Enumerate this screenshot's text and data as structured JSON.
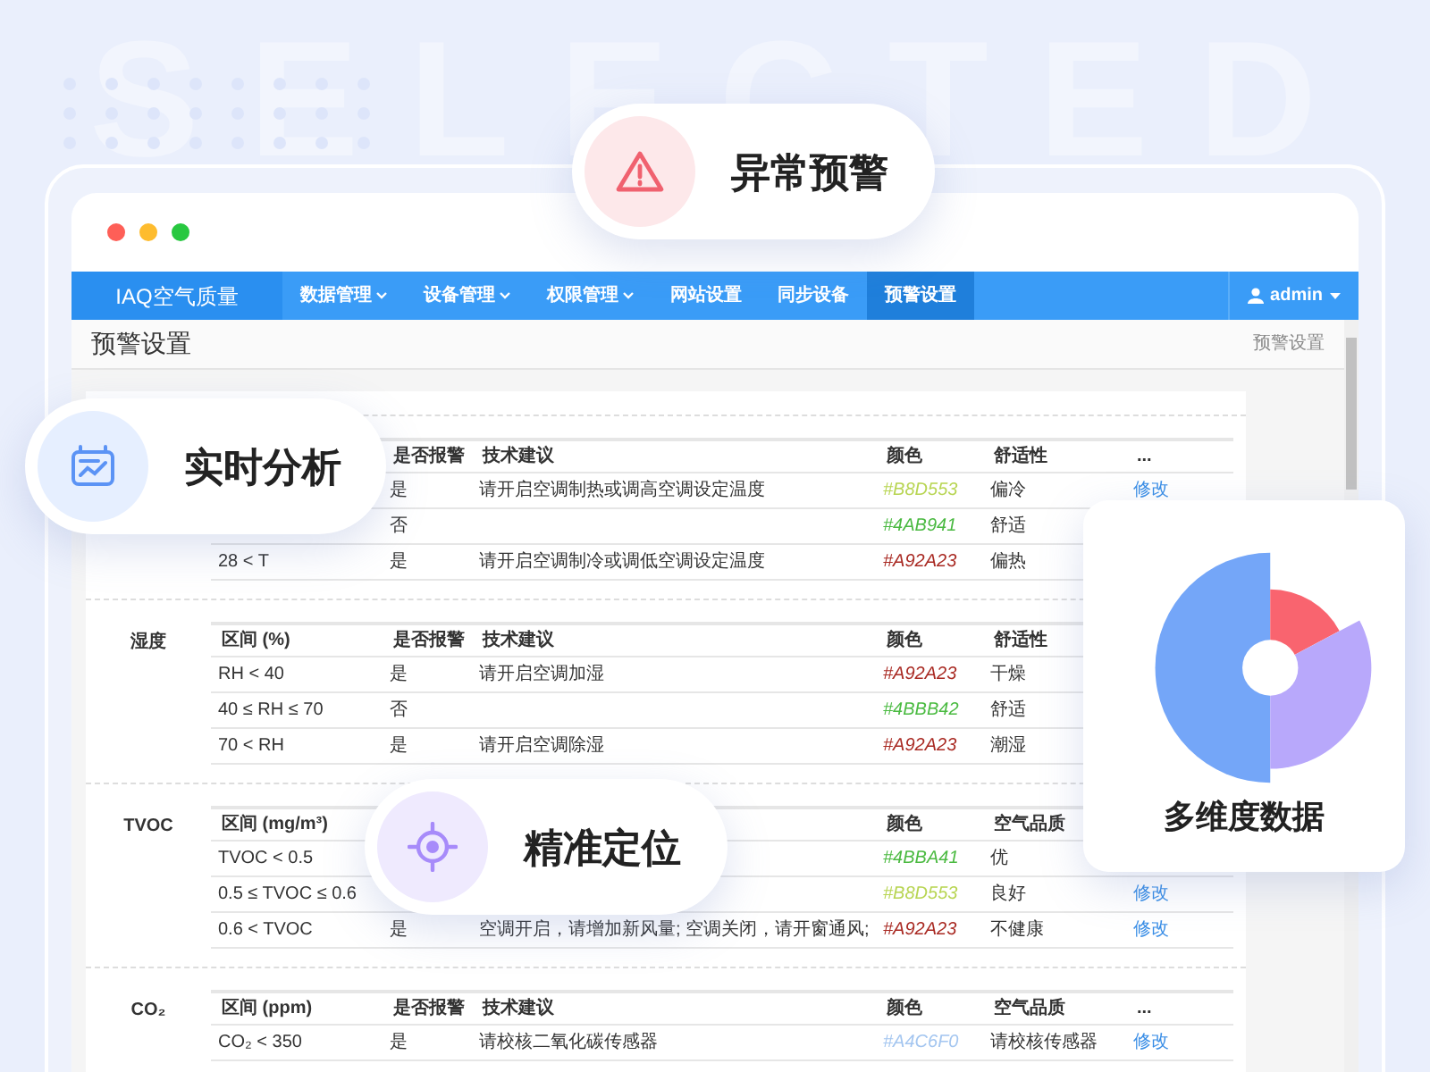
{
  "background_text": "SELECTED",
  "badges": [
    {
      "kind": "warning",
      "label": "异常预警"
    },
    {
      "kind": "analysis",
      "label": "实时分析"
    },
    {
      "kind": "locate",
      "label": "精准定位"
    }
  ],
  "chart_card": {
    "label": "多维度数据"
  },
  "window": {
    "brand": "IAQ空气质量",
    "nav": [
      {
        "label": "数据管理",
        "has_menu": true,
        "selected": false
      },
      {
        "label": "设备管理",
        "has_menu": true,
        "selected": false
      },
      {
        "label": "权限管理",
        "has_menu": true,
        "selected": false
      },
      {
        "label": "网站设置",
        "has_menu": false,
        "selected": false
      },
      {
        "label": "同步设备",
        "has_menu": false,
        "selected": false
      },
      {
        "label": "预警设置",
        "has_menu": false,
        "selected": true
      }
    ],
    "user": "admin",
    "page_title": "预警设置",
    "breadcrumb": "预警设置",
    "sections": [
      {
        "columns": [
          null,
          "是否报警",
          "技术建议",
          "颜色",
          "舒适性",
          "..."
        ],
        "rows": [
          {
            "cells": [
              null,
              "是",
              "请开启空调制热或调高空调设定温度",
              {
                "text": "#B8D553",
                "color": "#b8d553"
              },
              "偏冷",
              "修改"
            ]
          },
          {
            "cells": [
              null,
              "否",
              null,
              {
                "text": "#4AB941",
                "color": "#4ab941"
              },
              "舒适",
              null
            ]
          },
          {
            "cells": [
              "28 < T",
              "是",
              "请开启空调制冷或调低空调设定温度",
              {
                "text": "#A92A23",
                "color": "#a92a23"
              },
              "偏热",
              null
            ]
          }
        ]
      },
      {
        "label": "湿度",
        "columns": [
          "区间 (%)",
          "是否报警",
          "技术建议",
          "颜色",
          "舒适性",
          null
        ],
        "rows": [
          {
            "cells": [
              "RH < 40",
              "是",
              "请开启空调加湿",
              {
                "text": "#A92A23",
                "color": "#a92a23"
              },
              "干燥",
              null
            ]
          },
          {
            "cells": [
              "40 ≤ RH ≤ 70",
              "否",
              null,
              {
                "text": "#4BBB42",
                "color": "#4bbb42"
              },
              "舒适",
              null
            ]
          },
          {
            "cells": [
              "70 < RH",
              "是",
              "请开启空调除湿",
              {
                "text": "#A92A23",
                "color": "#a92a23"
              },
              "潮湿",
              null
            ]
          }
        ]
      },
      {
        "label": "TVOC",
        "columns": [
          "区间 (mg/m³)",
          null,
          null,
          "颜色",
          "空气品质",
          null
        ],
        "rows": [
          {
            "cells": [
              "TVOC < 0.5",
              null,
              null,
              {
                "text": "#4BBA41",
                "color": "#4bba41"
              },
              "优",
              null
            ]
          },
          {
            "cells": [
              "0.5 ≤ TVOC ≤ 0.6",
              null,
              null,
              {
                "text": "#B8D553",
                "color": "#b8d553"
              },
              "良好",
              "修改"
            ]
          },
          {
            "cells": [
              "0.6 < TVOC",
              "是",
              "空调开启，请增加新风量; 空调关闭，请开窗通风;",
              {
                "text": "#A92A23",
                "color": "#a92a23"
              },
              "不健康",
              "修改"
            ]
          }
        ]
      },
      {
        "label": "CO₂",
        "columns": [
          "区间 (ppm)",
          "是否报警",
          "技术建议",
          "颜色",
          "空气品质",
          "..."
        ],
        "rows": [
          {
            "cells": [
              "CO₂ < 350",
              "是",
              "请校核二氧化碳传感器",
              {
                "text": "#A4C6F0",
                "color": "#a4c6f0"
              },
              "请校核传感器",
              "修改"
            ]
          }
        ]
      }
    ]
  }
}
